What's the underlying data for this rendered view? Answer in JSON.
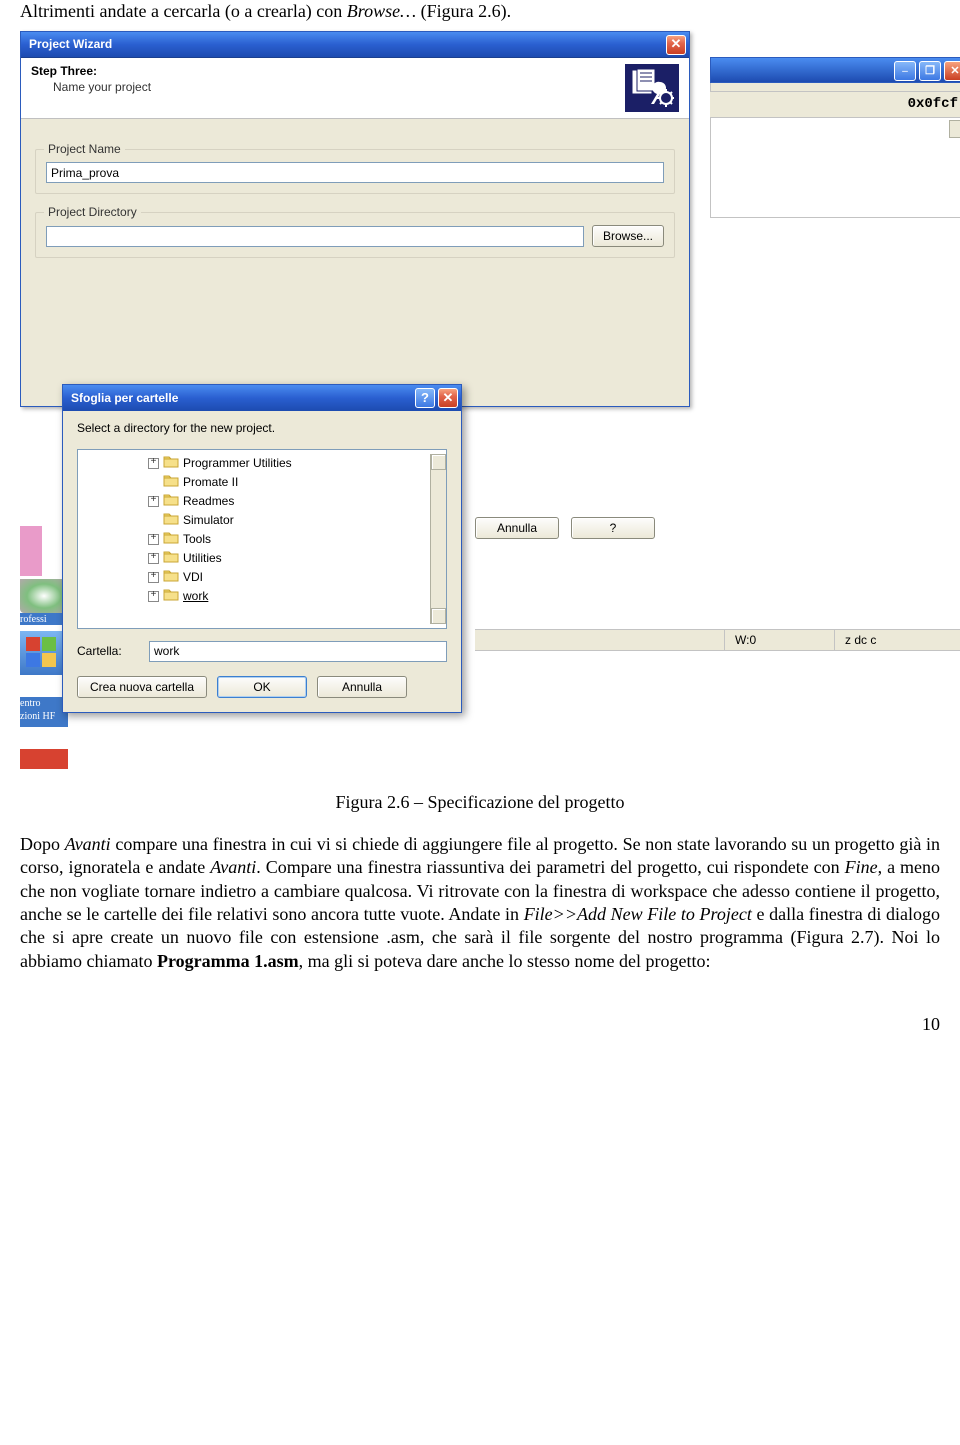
{
  "intro": "Altrimenti andate a cercarla (o a crearla) con ",
  "intro_italic": "Browse…",
  "intro_tail": " (Figura 2.6).",
  "wizard": {
    "title": "Project Wizard",
    "step": "Step Three:",
    "subtitle": "Name your project",
    "project_name_legend": "Project Name",
    "project_name_value": "Prima_prova",
    "project_dir_legend": "Project Directory",
    "project_dir_value": "",
    "browse_label": "Browse..."
  },
  "bg": {
    "opcode": "0x0fcf",
    "annulla": "Annulla",
    "question": "?",
    "status_w": "W:0",
    "status_z": "z dc c"
  },
  "browse": {
    "title": "Sfoglia per cartelle",
    "instr": "Select a directory for the new project.",
    "folders": [
      {
        "plus": true,
        "label": "Programmer Utilities"
      },
      {
        "plus": false,
        "label": "Promate II"
      },
      {
        "plus": true,
        "label": "Readmes"
      },
      {
        "plus": false,
        "label": "Simulator"
      },
      {
        "plus": true,
        "label": "Tools"
      },
      {
        "plus": true,
        "label": "Utilities"
      },
      {
        "plus": true,
        "label": "VDI"
      },
      {
        "plus": true,
        "label": "work",
        "selected": true
      }
    ],
    "cartella_label": "Cartella:",
    "cartella_value": "work",
    "newfolder": "Crea nuova cartella",
    "ok": "OK",
    "cancel": "Annulla"
  },
  "desk": {
    "label1": "rofessi",
    "label2": "entro\nzioni HF"
  },
  "caption": "Figura 2.6 – Specificazione del progetto",
  "body1a": "Dopo ",
  "body1b": "Avanti",
  "body1c": " compare una finestra in cui vi si chiede di aggiungere file al progetto. Se non state lavorando su un progetto già in corso, ignoratela e andate ",
  "body1d": "Avanti",
  "body1e": ". Compare una finestra riassuntiva dei parametri del progetto, cui rispondete con ",
  "body1f": "Fine",
  "body1g": ", a meno che non vogliate tornare indietro a cambiare qualcosa. Vi ritrovate con la finestra di workspace che adesso contiene il progetto, anche se le cartelle dei file relativi sono ancora tutte vuote. Andate in ",
  "body1h": "File>>Add New File to Project",
  "body1i": " e dalla finestra di dialogo che si apre create un nuovo file con estensione .asm, che sarà il file sorgente del nostro programma (Figura 2.7). Noi lo abbiamo chiamato ",
  "body1j": "Programma 1.asm",
  "body1k": ", ma gli si poteva dare anche lo stesso nome del progetto:",
  "pagenum": "10"
}
